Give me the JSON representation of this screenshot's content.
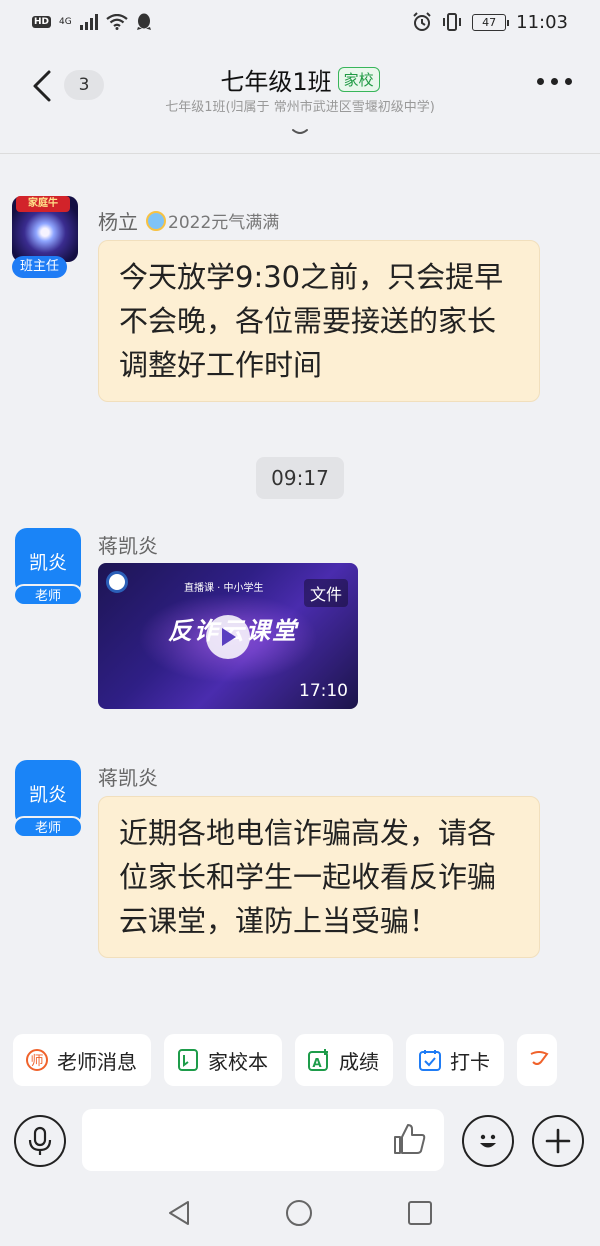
{
  "status_bar": {
    "left_badges": [
      "HD",
      "4G"
    ],
    "battery": "47",
    "time": "11:03"
  },
  "header": {
    "unread_count": "3",
    "title": "七年级1班",
    "tag": "家校",
    "subtitle": "七年级1班(归属于 常州市武进区雪堰初级中学)"
  },
  "messages": [
    {
      "sender": "杨立",
      "medal": "2022元气满满",
      "avatar_banner": "家庭牛",
      "role": "班主任",
      "text": "今天放学9:30之前，只会提早不会晚，各位需要接送的家长调整好工作时间"
    },
    {
      "time_divider": "09:17"
    },
    {
      "sender": "蒋凯炎",
      "avatar_text": "凯炎",
      "role": "老师",
      "video": {
        "tag": "文件",
        "title": "反诈云课堂",
        "subtitle": "直播课 · 中小学生",
        "duration": "17:10"
      }
    },
    {
      "sender": "蒋凯炎",
      "avatar_text": "凯炎",
      "role": "老师",
      "text": "近期各地电信诈骗高发，请各位家长和学生一起收看反诈骗云课堂，谨防上当受骗！"
    }
  ],
  "quick_actions": [
    {
      "label": "老师消息",
      "icon": "teacher-icon",
      "color": "#f0622b"
    },
    {
      "label": "家校本",
      "icon": "notebook-icon",
      "color": "#1e9c4a"
    },
    {
      "label": "成绩",
      "icon": "grade-icon",
      "color": "#1e9c4a"
    },
    {
      "label": "打卡",
      "icon": "checkin-icon",
      "color": "#1f7cf5"
    }
  ],
  "input": {
    "placeholder": ""
  },
  "colors": {
    "bubble": "#fdefd3",
    "accent_blue": "#1a84f7",
    "tag_green": "#1f9a43"
  }
}
